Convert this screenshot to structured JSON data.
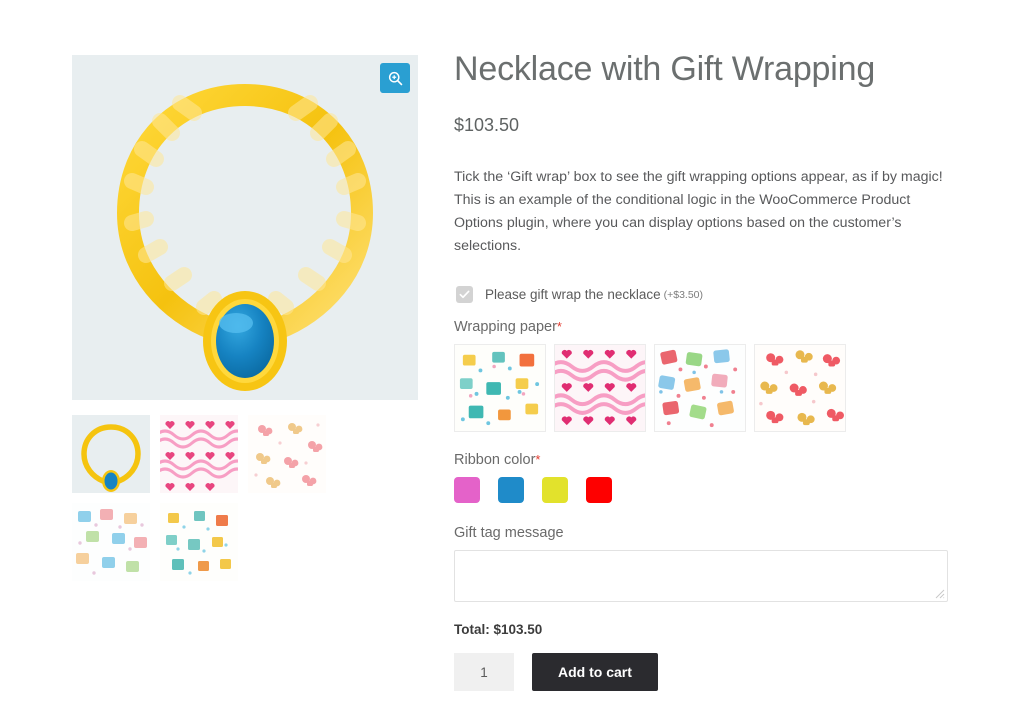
{
  "product": {
    "title": "Necklace with Gift Wrapping",
    "price": "$103.50",
    "description": "Tick the ‘Gift wrap’ box to see the gift wrapping options appear, as if by magic! This is an example of the conditional logic in the WooCommerce Product Options plugin, where you can display options based on the customer’s selections."
  },
  "gallery": {
    "zoom_icon": "magnifier-plus-icon",
    "main_image_alt": "gold-necklace-with-blue-gem",
    "background_color": "#e8eef0",
    "thumbnails": [
      {
        "name": "necklace",
        "selected": true
      },
      {
        "name": "pink-hearts-paper",
        "selected": false
      },
      {
        "name": "pink-bows-paper",
        "selected": false
      },
      {
        "name": "colorful-gifts-paper",
        "selected": false
      },
      {
        "name": "gift-boxes-paper",
        "selected": false
      }
    ]
  },
  "options": {
    "gift_wrap": {
      "checked": true,
      "label": "Please gift wrap the necklace",
      "price": "(+$3.50)"
    },
    "wrapping_paper": {
      "label": "Wrapping paper",
      "required_mark": "*",
      "choices": [
        {
          "name": "gift-boxes-paper"
        },
        {
          "name": "pink-hearts-paper"
        },
        {
          "name": "colorful-gifts-paper"
        },
        {
          "name": "pink-bows-paper"
        }
      ]
    },
    "ribbon_color": {
      "label": "Ribbon color",
      "required_mark": "*",
      "choices": [
        {
          "name": "pink",
          "hex": "#e462c9"
        },
        {
          "name": "blue",
          "hex": "#1f8bc9"
        },
        {
          "name": "yellow",
          "hex": "#e2e22c"
        },
        {
          "name": "red",
          "hex": "#fe0000"
        }
      ]
    },
    "gift_tag": {
      "label": "Gift tag message",
      "value": "",
      "placeholder": ""
    }
  },
  "cart": {
    "total_label": "Total: $103.50",
    "quantity": "1",
    "add_to_cart_label": "Add to cart"
  }
}
